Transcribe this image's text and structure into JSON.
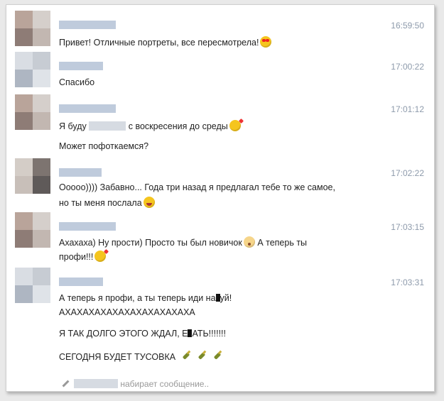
{
  "chat": {
    "messages": [
      {
        "time": "16:59:50",
        "lines": [
          "Привет! Отличные портреты, все пересмотрела!"
        ]
      },
      {
        "time": "17:00:22",
        "lines": [
          "Спасибо"
        ]
      },
      {
        "time": "17:01:12",
        "lines": [
          "Я буду",
          "с воскресения до среды",
          "Может пофоткаемся?"
        ]
      },
      {
        "time": "17:02:22",
        "lines": [
          "Оoooo)))) Забавно... Года три назад я предлагал тебе то же самое,",
          "но ты меня послала"
        ]
      },
      {
        "time": "17:03:15",
        "lines": [
          "Ахахаха) Ну прости) Просто ты был новичок",
          "А теперь ты",
          "профи!!!"
        ]
      },
      {
        "time": "17:03:31",
        "lines": [
          "А теперь я профи, а ты теперь иди на",
          "уй!",
          "АХАХАХАХАХАХАХАХАХАХАХА",
          "Я ТАК ДОЛГО ЭТОГО ЖДАЛ, Е",
          "АТЬ!!!!!!!",
          "СЕГОДНЯ БУДЕТ ТУСОВКА"
        ]
      }
    ],
    "typing_indicator": "набирает сообщение.."
  },
  "icons": [
    "heart-eyes-emoji",
    "kiss-emoji",
    "laugh-emoji",
    "shocked-emoji",
    "champagne-icon",
    "pencil-icon"
  ]
}
